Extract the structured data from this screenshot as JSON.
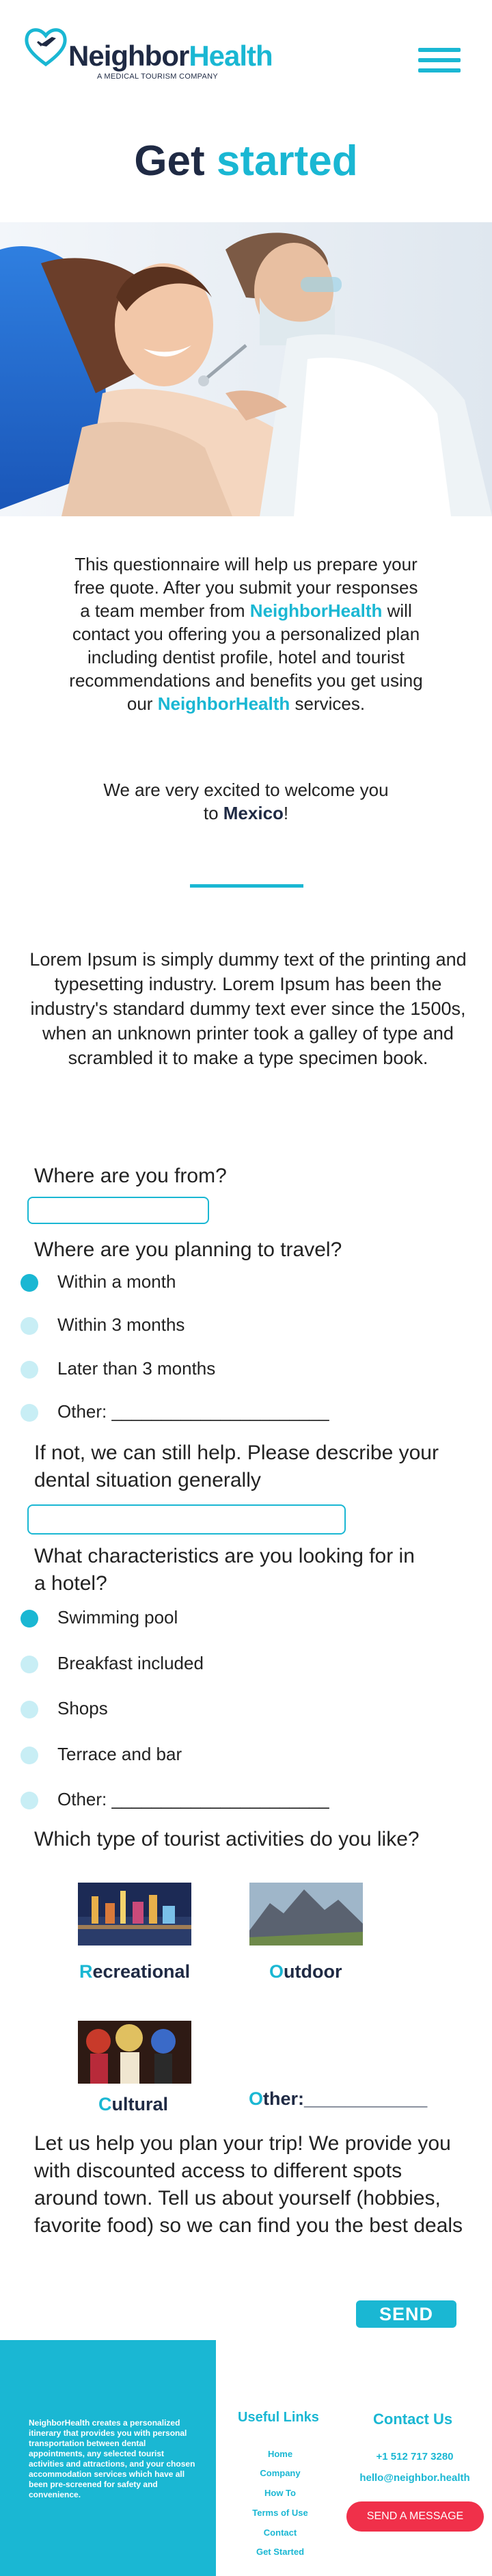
{
  "header": {
    "logo_word_1": "Neighbor",
    "logo_word_2": "Health",
    "logo_tagline": "A MEDICAL TOURISM COMPANY",
    "menu_icon": "hamburger-menu-icon"
  },
  "hero": {
    "title_1": "Get",
    "title_2": "started"
  },
  "intro": {
    "p1": "This questionnaire will help us prepare your free quote. After you submit your responses a team member from",
    "brand": "NeighborHealth",
    "p2": "will contact you offering you a personalized plan including dentist profile, hotel and tourist recommendations and benefits you get using our",
    "p3": "services.",
    "welcome_1": "We are very excited to welcome you to",
    "welcome_country": "Mexico",
    "welcome_end": "!"
  },
  "lorem": "Lorem Ipsum is simply dummy text of the printing and typesetting industry. Lorem Ipsum has been the industry's standard dummy text ever since the 1500s, when an unknown printer took a galley of type and scrambled it to make a type specimen book.",
  "form": {
    "q_from": "Where are you from?",
    "from_value": "",
    "q_travel": "Where are you planning to travel?",
    "travel_options": [
      "Within a month",
      "Within 3 months",
      "Later than 3 months",
      "Other: ______________________"
    ],
    "travel_selected": 0,
    "q_dental": "If not, we can still help. Please describe your dental situation generally",
    "dental_value": "",
    "q_hotel": "What characteristics are you looking for in a hotel?",
    "hotel_options": [
      "Swimming pool",
      "Breakfast included",
      "Shops",
      "Terrace and bar",
      "Other: ______________________"
    ],
    "hotel_selected": 0,
    "q_activities": "Which type of tourist activities do you like?",
    "activities": [
      {
        "first": "R",
        "rest": "ecreational"
      },
      {
        "first": "O",
        "rest": "utdoor"
      },
      {
        "first": "C",
        "rest": "ultural"
      },
      {
        "first": "O",
        "rest": "ther:____________"
      }
    ],
    "plan_text": "Let us help you plan your trip! We provide you with discounted access to different spots around town. Tell us about yourself (hobbies, favorite food) so we can find you the best deals",
    "send_label": "SEND"
  },
  "footer": {
    "about": "NeighborHealth creates a personalized itinerary that provides you with personal transportation between dental appointments, any selected tourist activities and attractions, and your chosen accommodation services which have all been pre-screened for safety and convenience.",
    "links_title": "Useful Links",
    "links": [
      "Home",
      "Company",
      "How To",
      "Terms of Use",
      "Contact",
      "Get Started"
    ],
    "contact_title": "Contact Us",
    "phone": "+1 512 717 3280",
    "email": "hello@neighbor.health",
    "message_button": "SEND A MESSAGE"
  },
  "colors": {
    "accent": "#1ab7d3",
    "navy": "#1f2a44",
    "radio_off": "#c8eef5",
    "button_red": "#f0304a"
  }
}
